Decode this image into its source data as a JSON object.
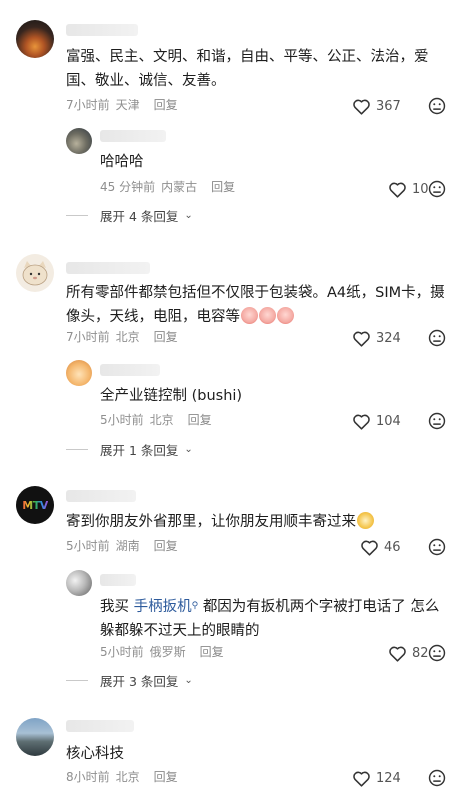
{
  "comments": [
    {
      "text": "富强、民主、文明、和谐，自由、平等、公正、法治，爱国、敬业、诚信、友善。",
      "time": "7小时前",
      "location": "天津",
      "reply_label": "回复",
      "likes": "367",
      "replies": [
        {
          "text": "哈哈哈",
          "time": "45 分钟前",
          "location": "内蒙古",
          "reply_label": "回复",
          "likes": "10"
        }
      ],
      "expand_label": "展开 4 条回复"
    },
    {
      "text_main": "所有零部件都禁包括但不仅限于包装袋。A4纸，SIM卡，摄像头，天线，电阻，电容等",
      "time": "7小时前",
      "location": "北京",
      "reply_label": "回复",
      "likes": "324",
      "replies": [
        {
          "text": "全产业链控制 (bushi)",
          "time": "5小时前",
          "location": "北京",
          "reply_label": "回复",
          "likes": "104"
        }
      ],
      "expand_label": "展开 1 条回复"
    },
    {
      "avatar_text": "MTV",
      "text_main": "寄到你朋友外省那里，让你朋友用顺丰寄过来",
      "time": "5小时前",
      "location": "湖南",
      "reply_label": "回复",
      "likes": "46",
      "replies": [
        {
          "prefix": "我买",
          "link": "手柄扳机",
          "suffix": "都因为有扳机两个字被打电话了 怎么躲都躲不过天上的眼睛的",
          "time": "5小时前",
          "location": "俄罗斯",
          "reply_label": "回复",
          "likes": "82"
        }
      ],
      "expand_label": "展开 3 条回复"
    },
    {
      "text": "核心科技",
      "time": "8小时前",
      "location": "北京",
      "reply_label": "回复",
      "likes": "124"
    }
  ],
  "icons": {
    "like": "heart-outline-icon",
    "dislike": "frown-face-icon",
    "expand": "chevron-down-icon",
    "search": "search-icon"
  },
  "colors": {
    "link": "#2e5b9c",
    "meta": "#8f8f8f"
  }
}
